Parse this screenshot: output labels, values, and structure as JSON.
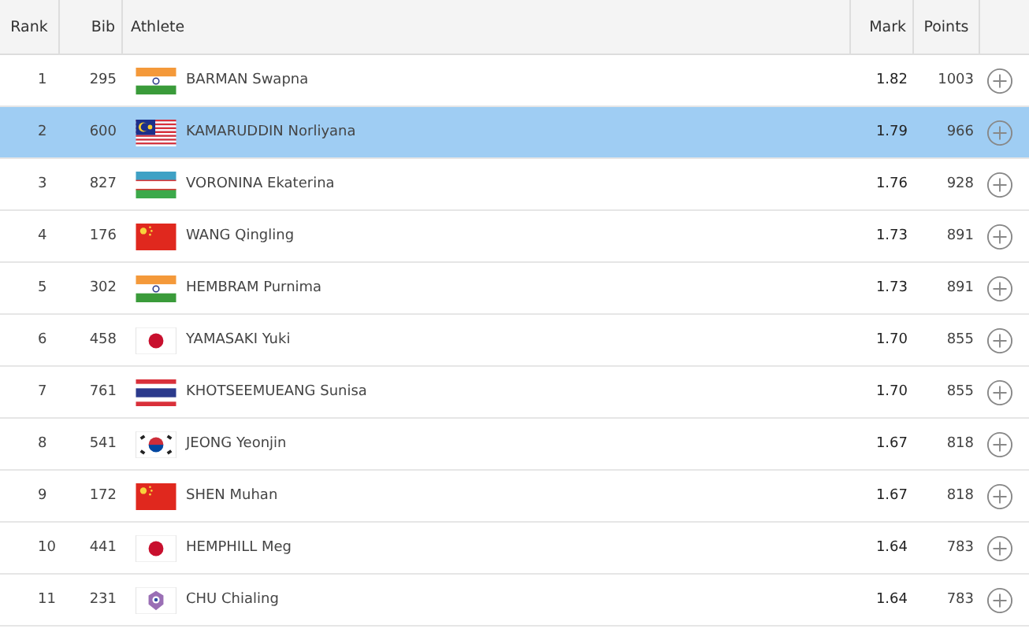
{
  "table": {
    "columns": [
      "Rank",
      "Bib",
      "Athlete",
      "Mark",
      "Points"
    ],
    "rows": [
      {
        "rank": "1",
        "bib": "295",
        "kind": "in",
        "athlete": "BARMAN Swapna",
        "mark": "1.82",
        "points": "1003",
        "selected": false
      },
      {
        "rank": "2",
        "bib": "600",
        "kind": "my",
        "athlete": "KAMARUDDIN Norliyana",
        "mark": "1.79",
        "points": "966",
        "selected": true
      },
      {
        "rank": "3",
        "bib": "827",
        "kind": "uz",
        "athlete": "VORONINA Ekaterina",
        "mark": "1.76",
        "points": "928",
        "selected": false
      },
      {
        "rank": "4",
        "bib": "176",
        "kind": "cn",
        "athlete": "WANG Qingling",
        "mark": "1.73",
        "points": "891",
        "selected": false
      },
      {
        "rank": "5",
        "bib": "302",
        "kind": "in",
        "athlete": "HEMBRAM Purnima",
        "mark": "1.73",
        "points": "891",
        "selected": false
      },
      {
        "rank": "6",
        "bib": "458",
        "kind": "jp",
        "athlete": "YAMASAKI Yuki",
        "mark": "1.70",
        "points": "855",
        "selected": false
      },
      {
        "rank": "7",
        "bib": "761",
        "kind": "th",
        "athlete": "KHOTSEEMUEANG Sunisa",
        "mark": "1.70",
        "points": "855",
        "selected": false
      },
      {
        "rank": "8",
        "bib": "541",
        "kind": "kr",
        "athlete": "JEONG Yeonjin",
        "mark": "1.67",
        "points": "818",
        "selected": false
      },
      {
        "rank": "9",
        "bib": "172",
        "kind": "cn",
        "athlete": "SHEN Muhan",
        "mark": "1.67",
        "points": "818",
        "selected": false
      },
      {
        "rank": "10",
        "bib": "441",
        "kind": "jp",
        "athlete": "HEMPHILL Meg",
        "mark": "1.64",
        "points": "783",
        "selected": false
      },
      {
        "rank": "11",
        "bib": "231",
        "kind": "tpe",
        "athlete": "CHU Chialing",
        "mark": "1.64",
        "points": "783",
        "selected": false
      }
    ]
  }
}
